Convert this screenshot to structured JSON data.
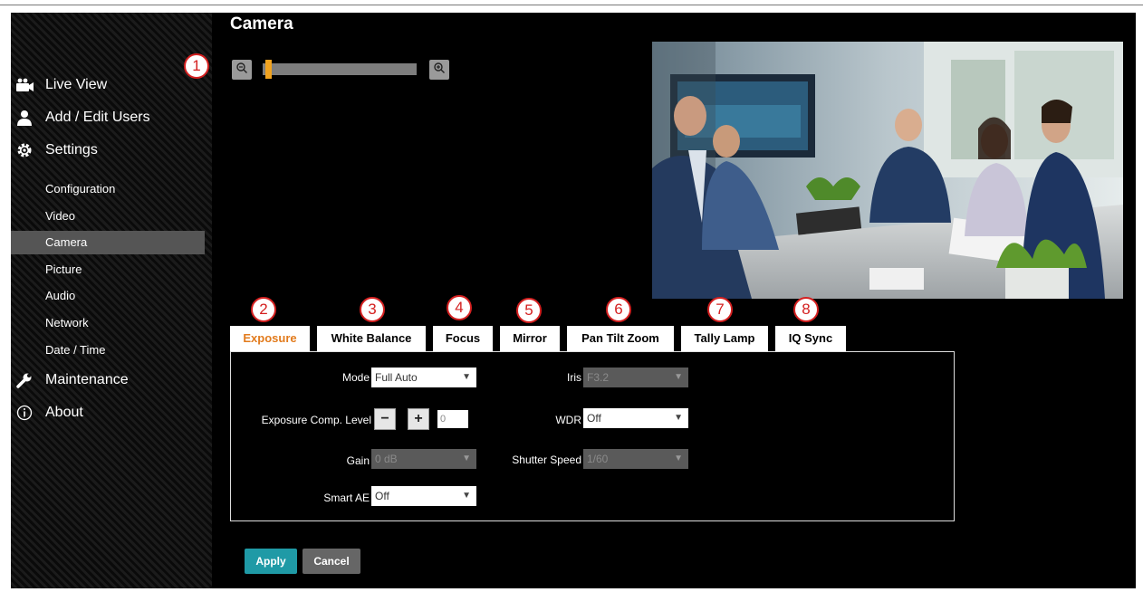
{
  "page": {
    "title": "Camera"
  },
  "sidebar": {
    "main_items": [
      {
        "label": "Live View",
        "icon": "live-view-icon"
      },
      {
        "label": "Add / Edit Users",
        "icon": "user-icon"
      },
      {
        "label": "Settings",
        "icon": "gear-icon"
      }
    ],
    "sub_items": [
      {
        "label": "Configuration"
      },
      {
        "label": "Video"
      },
      {
        "label": "Camera",
        "active": true
      },
      {
        "label": "Picture"
      },
      {
        "label": "Audio"
      },
      {
        "label": "Network"
      },
      {
        "label": "Date / Time"
      }
    ],
    "bottom_items": [
      {
        "label": "Maintenance",
        "icon": "wrench-icon"
      },
      {
        "label": "About",
        "icon": "info-icon"
      }
    ]
  },
  "zoom": {
    "level": 0.02,
    "out_icon": "zoom-out-icon",
    "in_icon": "zoom-in-icon"
  },
  "callouts": [
    "1",
    "2",
    "3",
    "4",
    "5",
    "6",
    "7",
    "8"
  ],
  "tabs": [
    {
      "label": "Exposure",
      "active": true
    },
    {
      "label": "White Balance"
    },
    {
      "label": "Focus"
    },
    {
      "label": "Mirror"
    },
    {
      "label": "Pan Tilt Zoom"
    },
    {
      "label": "Tally Lamp"
    },
    {
      "label": "IQ Sync"
    }
  ],
  "exposure": {
    "mode": {
      "label": "Mode",
      "value": "Full Auto"
    },
    "comp": {
      "label": "Exposure Comp. Level",
      "minus": "−",
      "plus": "+",
      "value": "0"
    },
    "gain": {
      "label": "Gain",
      "value": "0 dB"
    },
    "smart_ae": {
      "label": "Smart AE",
      "value": "Off"
    },
    "iris": {
      "label": "Iris",
      "value": "F3.2"
    },
    "wdr": {
      "label": "WDR",
      "value": "Off"
    },
    "shutter": {
      "label": "Shutter Speed",
      "value": "1/60"
    }
  },
  "actions": {
    "apply": "Apply",
    "cancel": "Cancel"
  },
  "colors": {
    "accent": "#e27b1d",
    "apply": "#1f9aa6",
    "cancel": "#666666",
    "callout": "#d42020",
    "zoom_thumb": "#f1a31f"
  }
}
